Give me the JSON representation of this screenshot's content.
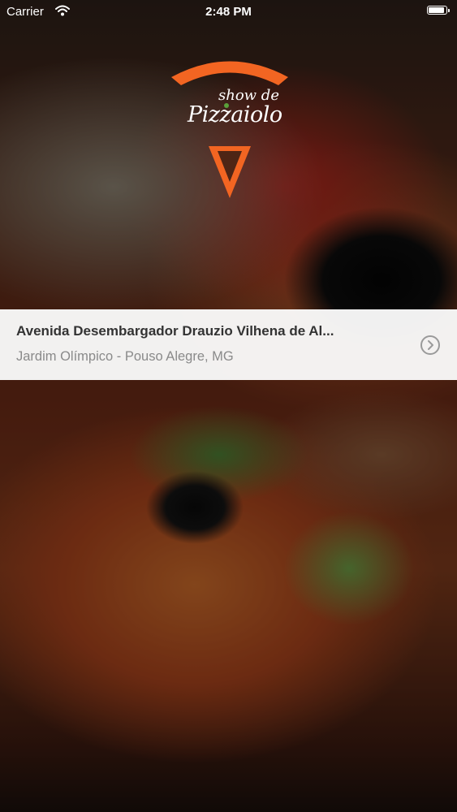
{
  "status_bar": {
    "carrier": "Carrier",
    "time": "2:48 PM",
    "battery_level": 0.95,
    "icons": [
      "wifi-icon",
      "battery-icon"
    ]
  },
  "logo": {
    "line1": "show de",
    "line2": "Pizzaiolo",
    "accent_color": "#f26522"
  },
  "location": {
    "street": "Avenida Desembargador Drauzio Vilhena de Al...",
    "neighborhood_city": "Jardim Olímpico - Pouso Alegre, MG",
    "action_icon": "chevron-right-circle-icon"
  },
  "background": {
    "image": "pizza-photo"
  }
}
